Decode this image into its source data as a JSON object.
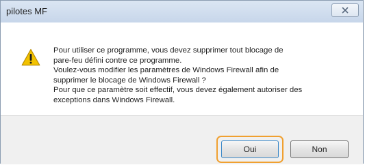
{
  "window": {
    "title": "pilotes MF",
    "close_icon": "close-icon"
  },
  "message": {
    "icon": "warning-icon",
    "lines": [
      "Pour utiliser ce programme, vous devez supprimer tout blocage de",
      "pare-feu défini contre ce programme.",
      "Voulez-vous modifier les paramètres de Windows Firewall afin de",
      "supprimer le blocage de Windows Firewall ?",
      "Pour que ce paramètre soit effectif, vous devez également autoriser des",
      "exceptions dans Windows Firewall."
    ]
  },
  "buttons": {
    "yes_label": "Oui",
    "no_label": "Non"
  },
  "colors": {
    "highlight": "#f0a030",
    "warning_fill": "#f2c200"
  }
}
